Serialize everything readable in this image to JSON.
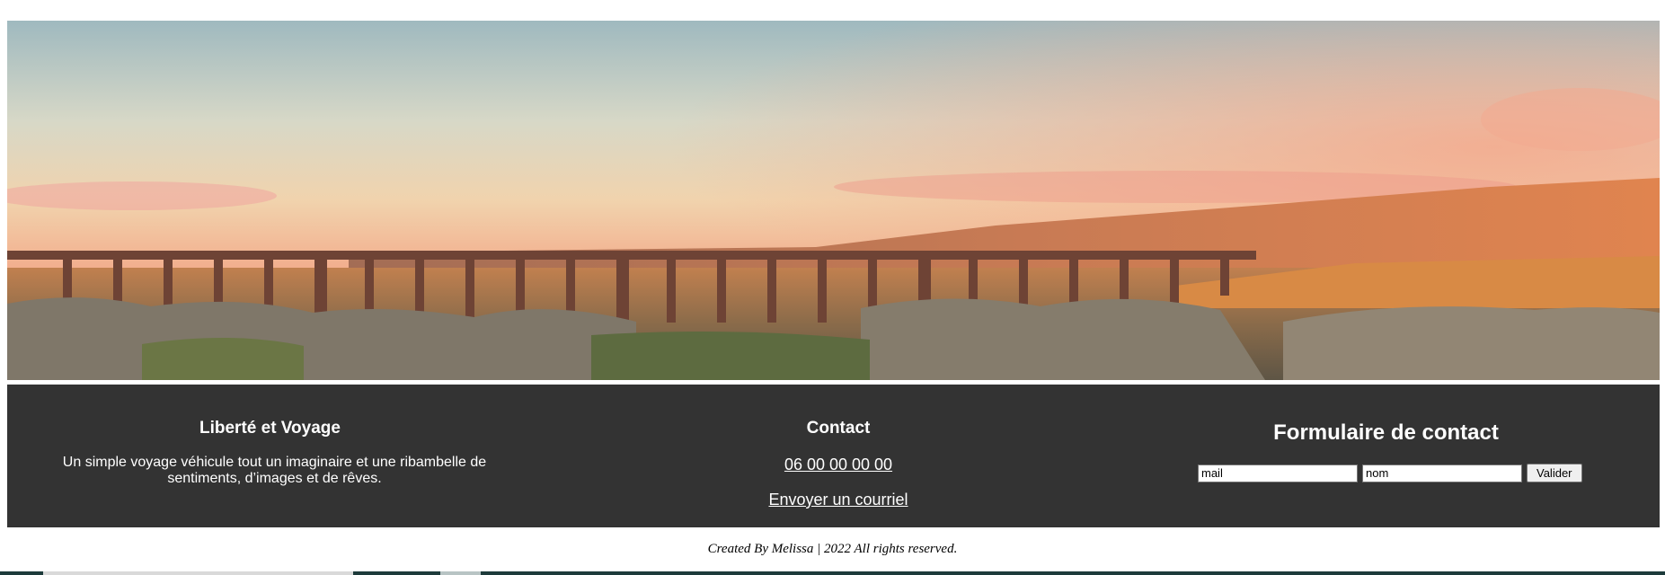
{
  "hero": {
    "image": "ribblehead-viaduct-sunset-landscape"
  },
  "about": {
    "title": "Liberté et Voyage",
    "text": "Un simple voyage véhicule tout un imaginaire et une ribambelle de sentiments, d’images et de rêves."
  },
  "contact": {
    "title": "Contact",
    "phone": "06 00 00 00 00",
    "email_link": "Envoyer un courriel"
  },
  "form": {
    "title": "Formulaire de contact",
    "mail_value": "mail",
    "name_value": "nom",
    "submit_label": "Valider"
  },
  "footer": {
    "credits": "Created By Melissa | 2022 All rights reserved."
  },
  "colors": {
    "footer_bg": "#333333",
    "text_light": "#ffffff"
  }
}
